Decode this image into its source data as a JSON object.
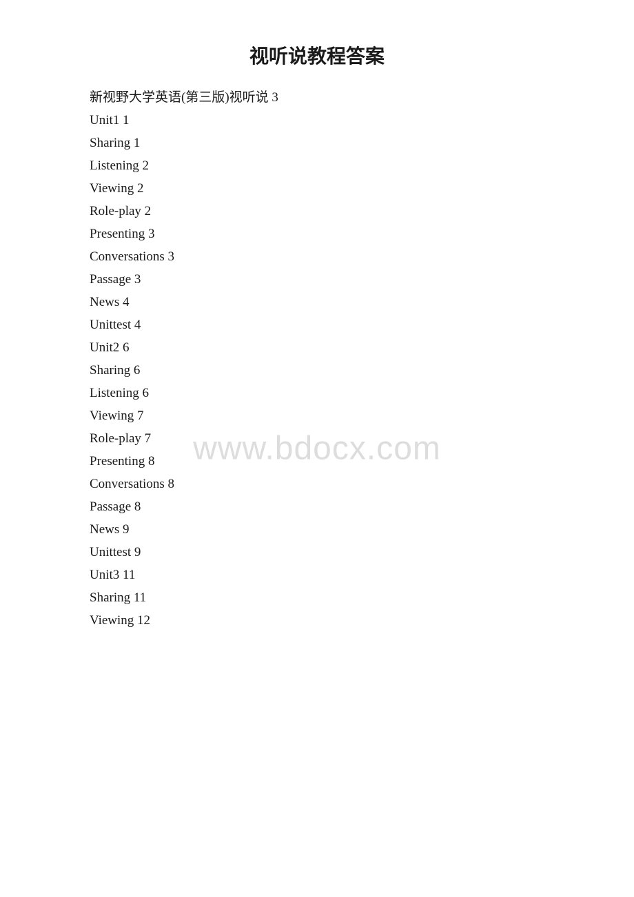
{
  "page": {
    "title": "视听说教程答案",
    "watermark": "www.bdocx.com"
  },
  "toc": [
    {
      "label": "新视野大学英语(第三版)视听说 3"
    },
    {
      "label": "Unit1 1"
    },
    {
      "label": "Sharing 1"
    },
    {
      "label": "Listening 2"
    },
    {
      "label": "Viewing 2"
    },
    {
      "label": "Role-play 2"
    },
    {
      "label": "Presenting 3"
    },
    {
      "label": "Conversations 3"
    },
    {
      "label": "Passage 3"
    },
    {
      "label": "News 4"
    },
    {
      "label": "Unittest 4"
    },
    {
      "label": "Unit2 6"
    },
    {
      "label": "Sharing 6"
    },
    {
      "label": "Listening 6"
    },
    {
      "label": "Viewing 7"
    },
    {
      "label": "Role-play 7"
    },
    {
      "label": "Presenting 8"
    },
    {
      "label": "Conversations 8"
    },
    {
      "label": "Passage 8"
    },
    {
      "label": "News 9"
    },
    {
      "label": "Unittest 9"
    },
    {
      "label": "Unit3 11"
    },
    {
      "label": "Sharing 11"
    },
    {
      "label": "Viewing 12"
    }
  ]
}
